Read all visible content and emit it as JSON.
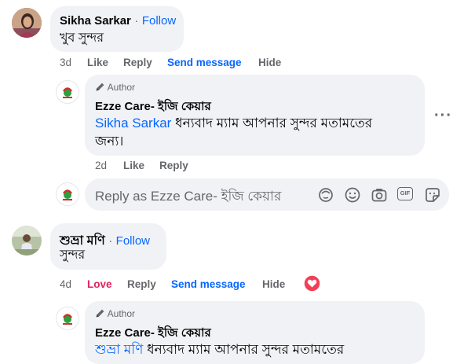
{
  "comments": [
    {
      "author": "Sikha Sarkar",
      "follow": "Follow",
      "separator": "·",
      "text": "খুব সুন্দর",
      "time": "3d",
      "actions": {
        "like": "Like",
        "reply": "Reply",
        "message": "Send message",
        "hide": "Hide"
      }
    },
    {
      "author": "শুভ্রা মণি",
      "follow": "Follow",
      "separator": "·",
      "text": "সুন্দর",
      "time": "4d",
      "actions": {
        "like": "Love",
        "reply": "Reply",
        "message": "Send message",
        "hide": "Hide"
      },
      "reaction_icon": "heart-reaction-icon"
    }
  ],
  "replies": [
    {
      "badge": "Author",
      "badge_icon": "pencil-icon",
      "author": "Ezze Care- ইজি কেয়ার",
      "mention": "Sikha Sarkar",
      "text_line1": " ধন্যবাদ ম্যাম আপনার সুন্দর মতামতের",
      "text_line2": "জন্য।",
      "time": "2d",
      "actions": {
        "like": "Like",
        "reply": "Reply"
      },
      "more": "···"
    },
    {
      "badge": "Author",
      "badge_icon": "pencil-icon",
      "author": "Ezze Care- ইজি কেয়ার",
      "mention": "শুভ্রা মণি",
      "text_line1": " ধন্যবাদ ম্যাম আপনার সুন্দর মতামতের"
    }
  ],
  "reply_box": {
    "placeholder": "Reply as Ezze Care- ইজি কেয়ার",
    "icons": [
      "avatar-sticker-icon",
      "emoji-icon",
      "camera-icon",
      "gif-icon",
      "sticker-icon"
    ],
    "gif_label": "GIF"
  },
  "colors": {
    "link": "#0866ff",
    "bubble": "#f0f2f5",
    "muted": "#65676b",
    "love": "#e0245e"
  }
}
